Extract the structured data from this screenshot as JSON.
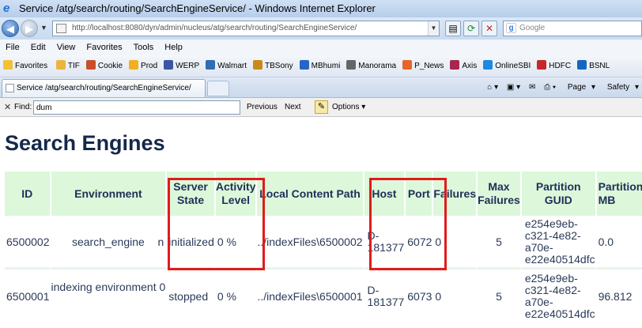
{
  "window": {
    "title": "Service /atg/search/routing/SearchEngineService/ - Windows Internet Explorer"
  },
  "address_bar": {
    "url": "http://localhost:8080/dyn/admin/nucleus/atg/search/routing/SearchEngineService/",
    "search_placeholder": "Google"
  },
  "menu": [
    "File",
    "Edit",
    "View",
    "Favorites",
    "Tools",
    "Help"
  ],
  "favorites": {
    "label": "Favorites",
    "items": [
      {
        "label": "TIF",
        "color": "#e8b640"
      },
      {
        "label": "Cookie",
        "color": "#c94f2a"
      },
      {
        "label": "Prod",
        "color": "#f0b020"
      },
      {
        "label": "WERP",
        "color": "#3a55a4"
      },
      {
        "label": "Walmart",
        "color": "#2f6db5"
      },
      {
        "label": "TBSony",
        "color": "#c98a1a"
      },
      {
        "label": "MBhumi",
        "color": "#2666c4"
      },
      {
        "label": "Manorama",
        "color": "#666666"
      },
      {
        "label": "P_News",
        "color": "#e4662a"
      },
      {
        "label": "Axis",
        "color": "#a8254d"
      },
      {
        "label": "OnlineSBI",
        "color": "#1e88e5"
      },
      {
        "label": "HDFC",
        "color": "#c62828"
      },
      {
        "label": "BSNL",
        "color": "#1565c0"
      }
    ]
  },
  "tab": {
    "label": "Service /atg/search/routing/SearchEngineService/"
  },
  "command_bar": {
    "page_label": "Page",
    "safety_label": "Safety"
  },
  "find_bar": {
    "label": "Find:",
    "value": "dum",
    "previous": "Previous",
    "next": "Next",
    "options": "Options"
  },
  "page": {
    "heading": "Search Engines",
    "columns": [
      "ID",
      "Environment",
      "Server State",
      "Activity Level",
      "Local Content Path",
      "Host",
      "Port",
      "Failures",
      "Max Failures",
      "Partition GUID",
      "Partition MB"
    ],
    "rows": [
      {
        "id": "6500002",
        "environment": "search_engine",
        "extra": "n",
        "server_state": "initialized",
        "activity_level": "0 %",
        "local_content_path": "../indexFiles\\6500002",
        "host": "D-181377",
        "port": "6072",
        "failures": "0",
        "max_failures": "5",
        "partition_guid": "e254e9eb-c321-4e82-a70e-e22e40514dfc",
        "partition_mb": "0.0"
      },
      {
        "id": "6500001",
        "environment": "indexing environment 0",
        "extra": "",
        "server_state": "stopped",
        "activity_level": "0 %",
        "local_content_path": "../indexFiles\\6500001",
        "host": "D-181377",
        "port": "6073",
        "failures": "0",
        "max_failures": "5",
        "partition_guid": "e254e9eb-c321-4e82-a70e-e22e40514dfc",
        "partition_mb": "96.812"
      }
    ]
  }
}
